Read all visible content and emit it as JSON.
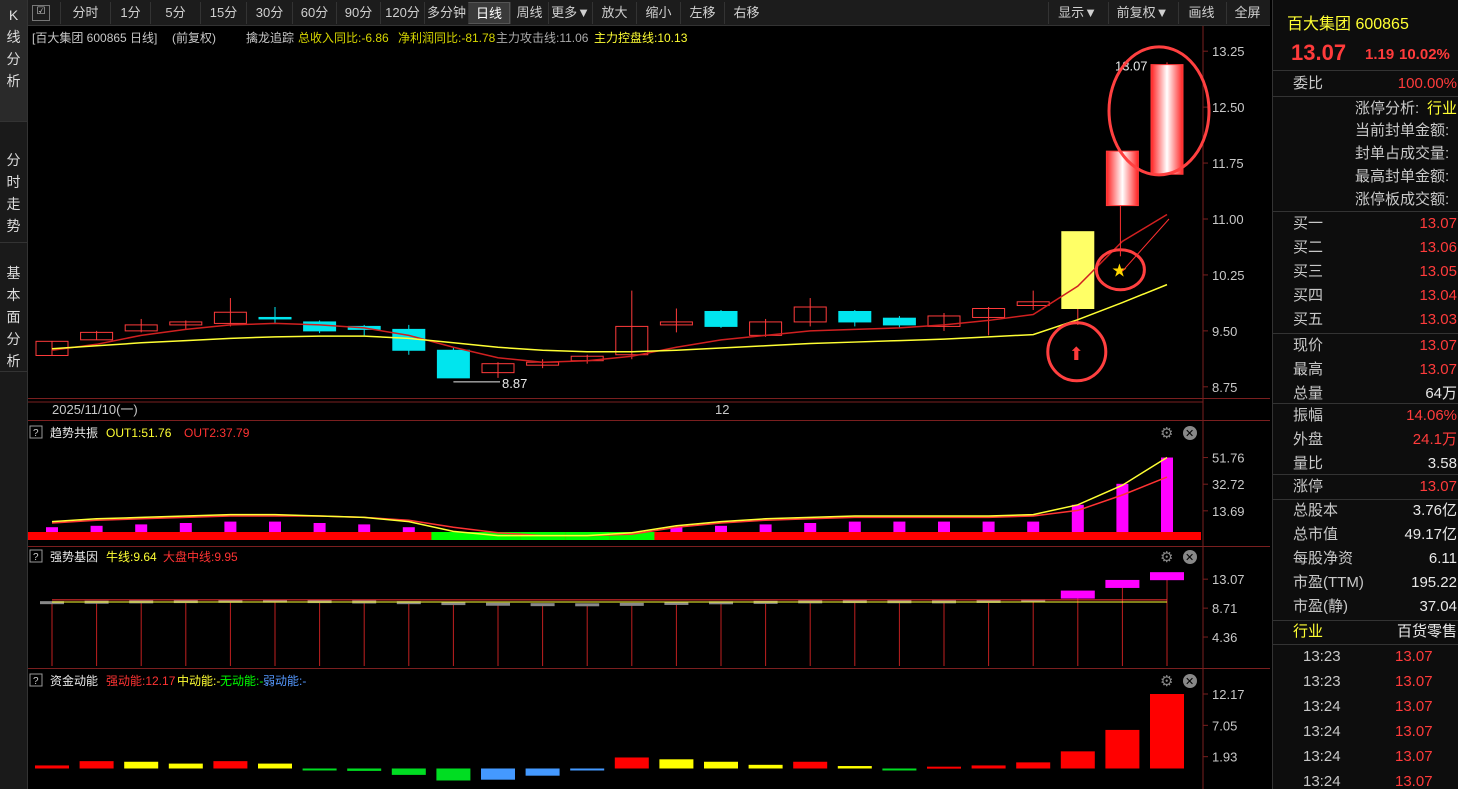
{
  "left_tabs": [
    {
      "label": "K线分析"
    },
    {
      "label": "分时走势"
    },
    {
      "label": "基本面分析"
    }
  ],
  "toolbar": {
    "items": [
      "分时",
      "1分",
      "5分",
      "15分",
      "30分",
      "60分",
      "90分",
      "120分",
      "多分钟",
      "日线",
      "周线",
      "更多▼",
      "放大",
      "缩小",
      "左移",
      "右移"
    ],
    "active": "日线",
    "right": [
      "显示▼",
      "前复权▼",
      "画线",
      "全屏"
    ]
  },
  "main_info": {
    "stock": "[百大集团 600865 日线]",
    "adj": "(前复权)",
    "indicator": "擒龙追踪",
    "income": "总收入同比:-6.86",
    "profit": "净利润同比:-81.78",
    "attack": "主力攻击线:11.06",
    "control": "主力控盘线:10.13"
  },
  "colors": {
    "up": "#ff3b3b",
    "down": "#00e5ee",
    "ma_yellow": "#ffff33",
    "ma_red": "#ff3333"
  },
  "chart_data": [
    {
      "type": "candlestick",
      "name": "日线",
      "y_ticks": [
        "13.25",
        "12.50",
        "11.75",
        "11.00",
        "10.25",
        "9.50",
        "8.75"
      ],
      "ylim": [
        8.6,
        13.4
      ],
      "x_labels": [
        "2025/11/10(一)",
        "12"
      ],
      "candles": [
        {
          "o": 9.17,
          "c": 9.36,
          "h": 9.36,
          "l": 9.17
        },
        {
          "o": 9.38,
          "c": 9.48,
          "h": 9.5,
          "l": 9.38
        },
        {
          "o": 9.5,
          "c": 9.58,
          "h": 9.66,
          "l": 9.48
        },
        {
          "o": 9.58,
          "c": 9.62,
          "h": 9.64,
          "l": 9.52
        },
        {
          "o": 9.6,
          "c": 9.75,
          "h": 9.94,
          "l": 9.56
        },
        {
          "o": 9.68,
          "c": 9.66,
          "h": 9.82,
          "l": 9.6
        },
        {
          "o": 9.62,
          "c": 9.5,
          "h": 9.64,
          "l": 9.47
        },
        {
          "o": 9.56,
          "c": 9.52,
          "h": 9.58,
          "l": 9.44
        },
        {
          "o": 9.52,
          "c": 9.24,
          "h": 9.58,
          "l": 9.18
        },
        {
          "o": 9.24,
          "c": 8.87,
          "h": 9.28,
          "l": 8.87
        },
        {
          "o": 8.94,
          "c": 9.06,
          "h": 9.08,
          "l": 8.87
        },
        {
          "o": 9.04,
          "c": 9.08,
          "h": 9.12,
          "l": 9.0
        },
        {
          "o": 9.1,
          "c": 9.16,
          "h": 9.18,
          "l": 9.06
        },
        {
          "o": 9.18,
          "c": 9.56,
          "h": 10.04,
          "l": 9.12
        },
        {
          "o": 9.58,
          "c": 9.62,
          "h": 9.8,
          "l": 9.48
        },
        {
          "o": 9.76,
          "c": 9.56,
          "h": 9.78,
          "l": 9.54
        },
        {
          "o": 9.44,
          "c": 9.62,
          "h": 9.66,
          "l": 9.42
        },
        {
          "o": 9.62,
          "c": 9.82,
          "h": 9.94,
          "l": 9.56
        },
        {
          "o": 9.76,
          "c": 9.62,
          "h": 9.78,
          "l": 9.56
        },
        {
          "o": 9.67,
          "c": 9.58,
          "h": 9.7,
          "l": 9.54
        },
        {
          "o": 9.56,
          "c": 9.7,
          "h": 9.74,
          "l": 9.5
        },
        {
          "o": 9.68,
          "c": 9.8,
          "h": 9.82,
          "l": 9.44
        },
        {
          "o": 9.84,
          "c": 9.89,
          "h": 10.04,
          "l": 9.78
        },
        {
          "o": 9.8,
          "c": 10.83,
          "h": 10.83,
          "l": 9.58
        },
        {
          "o": 11.18,
          "c": 11.91,
          "h": 11.91,
          "l": 11.18
        },
        {
          "o": 11.6,
          "c": 13.07,
          "h": 13.1,
          "l": 11.6
        }
      ],
      "ma_yellow": [
        9.26,
        9.3,
        9.34,
        9.37,
        9.4,
        9.42,
        9.43,
        9.43,
        9.4,
        9.34,
        9.28,
        9.24,
        9.22,
        9.22,
        9.24,
        9.27,
        9.3,
        9.33,
        9.35,
        9.37,
        9.39,
        9.42,
        9.45,
        9.65,
        9.88,
        10.12
      ],
      "ma_red": [
        9.24,
        9.32,
        9.44,
        9.52,
        9.58,
        9.6,
        9.58,
        9.54,
        9.44,
        9.28,
        9.14,
        9.08,
        9.1,
        9.16,
        9.28,
        9.38,
        9.44,
        9.5,
        9.52,
        9.54,
        9.58,
        9.64,
        9.72,
        10.1,
        10.7,
        11.06
      ],
      "annotations": [
        {
          "text": "13.07"
        },
        {
          "text": "8.87"
        }
      ]
    },
    {
      "type": "bar",
      "name": "趋势共振",
      "legend": [
        "OUT1:51.76",
        "OUT2:37.79"
      ],
      "y_ticks": [
        "51.76",
        "32.72",
        "13.69"
      ],
      "ylim": [
        0,
        60
      ],
      "values": [
        2,
        3,
        4,
        5,
        6,
        6,
        5,
        4,
        2,
        -2,
        -3,
        -3,
        -3,
        -2,
        2,
        3,
        4,
        5,
        6,
        6,
        6,
        6,
        6,
        18,
        33,
        51.76
      ],
      "out1": [
        6,
        8,
        9,
        10,
        11,
        11,
        10,
        9,
        6,
        -1,
        -4,
        -4,
        -4,
        -2,
        3,
        6,
        8,
        9,
        10,
        10,
        10,
        10,
        11,
        18,
        32,
        51.76
      ],
      "out2": [
        5,
        7,
        8,
        9,
        10,
        10,
        10,
        9,
        7,
        2,
        -2,
        -4,
        -4,
        -3,
        2,
        5,
        7,
        8,
        9,
        9,
        9,
        9,
        10,
        14,
        25,
        37.79
      ]
    },
    {
      "type": "bar",
      "name": "强势基因",
      "legend": [
        "牛线:9.64",
        "大盘中线:9.95"
      ],
      "y_ticks": [
        "13.07",
        "8.71",
        "4.36"
      ],
      "ylim": [
        0,
        14.3
      ],
      "values": [
        9.46,
        9.52,
        9.58,
        9.62,
        9.66,
        9.68,
        9.62,
        9.56,
        9.46,
        9.32,
        9.22,
        9.16,
        9.14,
        9.2,
        9.34,
        9.44,
        9.5,
        9.58,
        9.62,
        9.6,
        9.58,
        9.64,
        9.72,
        10.3,
        11.9,
        13.07
      ],
      "bull": 9.64,
      "mid": 9.95
    },
    {
      "type": "bar",
      "name": "资金动能",
      "legend": [
        "强动能:12.17",
        "中动能:-",
        "无动能:-",
        "弱动能:-"
      ],
      "y_ticks": [
        "12.17",
        "7.05",
        "1.93"
      ],
      "ylim": [
        -0.9,
        12.17
      ],
      "values": [
        0.5,
        1.2,
        1.1,
        0.8,
        1.2,
        0.8,
        0.2,
        0.3,
        0.8,
        1.5,
        1.4,
        0.9,
        0.2,
        1.8,
        1.5,
        1.1,
        0.6,
        1.1,
        0.4,
        0.2,
        0.3,
        0.5,
        1.0,
        2.8,
        6.3,
        12.17
      ],
      "groups": [
        "强",
        "强",
        "中",
        "中",
        "强",
        "中",
        "无",
        "无",
        "无",
        "无",
        "弱",
        "弱",
        "弱",
        "强",
        "中",
        "中",
        "中",
        "强",
        "中",
        "无",
        "强",
        "强",
        "强",
        "强",
        "强",
        "强"
      ]
    }
  ],
  "quote": {
    "name": "百大集团 600865",
    "price": "13.07",
    "change": "1.19",
    "pct": "10.02%",
    "weibi_label": "委比",
    "weibi": "100.00%",
    "zt_title": "涨停分析:",
    "zt_industry": "行业",
    "zt_rows": [
      "当前封单金额:",
      "封单占成交量:",
      "最高封单金额:",
      "涨停板成交额:"
    ],
    "buys": [
      {
        "label": "买一",
        "price": "13.07"
      },
      {
        "label": "买二",
        "price": "13.06"
      },
      {
        "label": "买三",
        "price": "13.05"
      },
      {
        "label": "买四",
        "price": "13.04"
      },
      {
        "label": "买五",
        "price": "13.03"
      }
    ],
    "stats1": [
      {
        "label": "现价",
        "value": "13.07"
      },
      {
        "label": "最高",
        "value": "13.07"
      },
      {
        "label": "总量",
        "value": "64万"
      }
    ],
    "stats2": [
      {
        "label": "振幅",
        "value": "14.06%"
      },
      {
        "label": "外盘",
        "value": "24.1万"
      },
      {
        "label": "量比",
        "value": "3.58"
      }
    ],
    "stats3": [
      {
        "label": "涨停",
        "value": "13.07"
      }
    ],
    "stats4": [
      {
        "label": "总股本",
        "value": "3.76亿"
      },
      {
        "label": "总市值",
        "value": "49.17亿"
      },
      {
        "label": "每股净资",
        "value": "6.11"
      },
      {
        "label": "市盈(TTM)",
        "value": "195.22"
      },
      {
        "label": "市盈(静)",
        "value": "37.04"
      }
    ],
    "industry_label": "行业",
    "industry": "百货零售",
    "ticks": [
      {
        "t": "13:23",
        "p": "13.07"
      },
      {
        "t": "13:23",
        "p": "13.07"
      },
      {
        "t": "13:24",
        "p": "13.07"
      },
      {
        "t": "13:24",
        "p": "13.07"
      },
      {
        "t": "13:24",
        "p": "13.07"
      },
      {
        "t": "13:24",
        "p": "13.07"
      }
    ]
  }
}
